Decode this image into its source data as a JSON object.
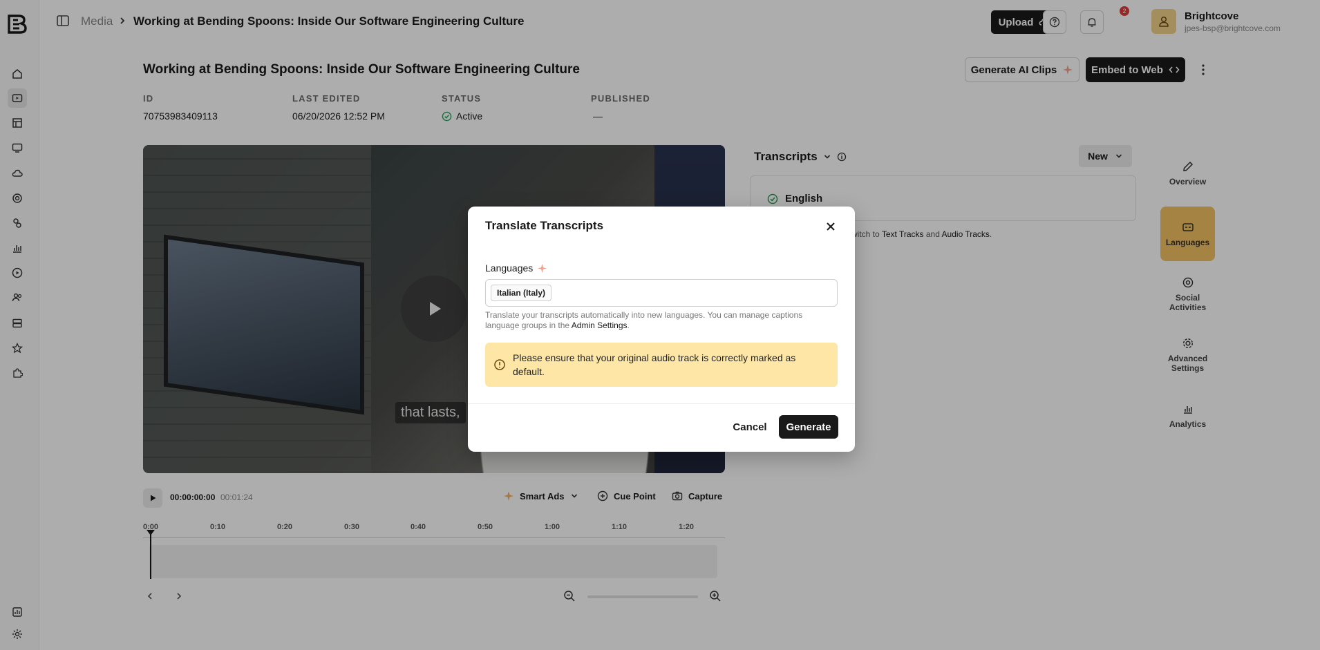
{
  "topbar": {
    "breadcrumb_root": "Media",
    "breadcrumb_current": "Working at Bending Spoons: Inside Our Software Engineering Culture",
    "upload_label": "Upload",
    "notification_count": "2",
    "account_name": "Brightcove",
    "account_email": "jpes-bsp@brightcove.com"
  },
  "page": {
    "title": "Working at Bending Spoons: Inside Our Software Engineering Culture",
    "generate_ai_clips_label": "Generate AI Clips",
    "embed_label": "Embed to Web"
  },
  "meta": {
    "id_label": "ID",
    "id_value": "70753983409113",
    "edited_label": "LAST EDITED",
    "edited_value": "06/20/2026 12:52 PM",
    "status_label": "STATUS",
    "status_value": "Active",
    "published_label": "PUBLISHED",
    "published_value": "—"
  },
  "video": {
    "caption": "that lasts,"
  },
  "controls": {
    "time_current": "00:00:00:00",
    "time_total": "00:01:24",
    "smart_ads_label": "Smart Ads",
    "cue_point_label": "Cue Point",
    "capture_label": "Capture",
    "ticks": [
      "0:00",
      "0:10",
      "0:20",
      "0:30",
      "0:40",
      "0:50",
      "1:00",
      "1:10",
      "1:20"
    ]
  },
  "transcripts": {
    "title": "Transcripts",
    "new_label": "New",
    "language": "English",
    "hint_prefix": "witch to",
    "hint_link1": "Text Tracks",
    "hint_mid": "and",
    "hint_link2": "Audio Tracks",
    "hint_suffix": "."
  },
  "right_tabs": [
    {
      "label": "Overview"
    },
    {
      "label": "Languages"
    },
    {
      "label": "Social Activities"
    },
    {
      "label": "Advanced Settings"
    },
    {
      "label": "Analytics"
    }
  ],
  "modal": {
    "title": "Translate Transcripts",
    "languages_label": "Languages",
    "selected_language": "Italian (Italy)",
    "help_text": "Translate your transcripts automatically into new languages. You can manage captions language groups in the",
    "help_link": "Admin Settings",
    "help_end": ".",
    "warning": "Please ensure that your original audio track is correctly marked as default.",
    "cancel_label": "Cancel",
    "generate_label": "Generate"
  },
  "colors": {
    "accent": "#f3c262",
    "warning_bg": "#fde6a6",
    "primary_button": "#1a1a1a",
    "status_active": "#2e9e5b"
  }
}
